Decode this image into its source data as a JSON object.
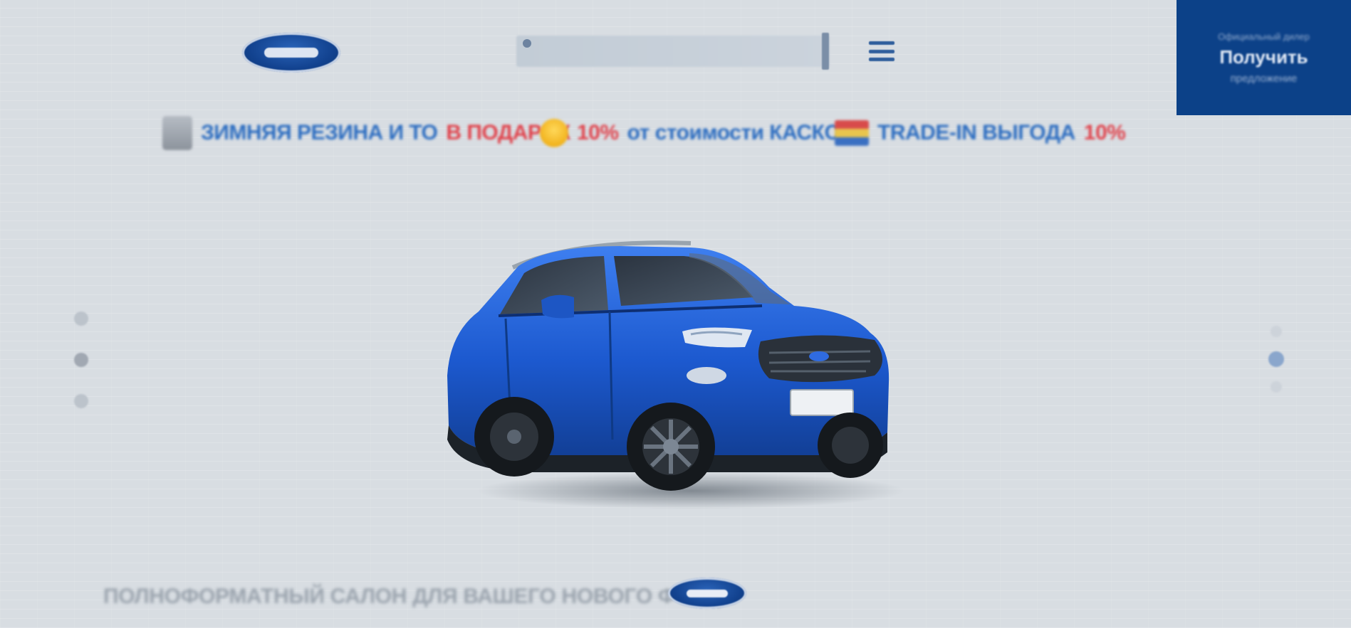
{
  "brand": {
    "logo_icon": "ford-oval-logo"
  },
  "header": {
    "search_icon": "search-icon",
    "menu_icon": "hamburger-menu-icon"
  },
  "promo_panel": {
    "line1": "Официальный дилер",
    "line2": "Получить",
    "line3": "предложение"
  },
  "benefits": [
    {
      "icon": "car-key-icon",
      "text_main": "ЗИМНЯЯ РЕЗИНА И ТО",
      "text_accent": "В ПОДАРОК"
    },
    {
      "icon": "gift-icon",
      "text_accent": "10%",
      "text_main": "от стоимости КАСКО*"
    },
    {
      "icon": "flag-icon",
      "text_main": "TRADE-IN ВЫГОДА",
      "text_accent": "10%"
    }
  ],
  "carousel": {
    "left_dots": 3,
    "right_dots": 3,
    "active_right_index": 1
  },
  "car": {
    "model": "Ford EcoSport",
    "color": "#1f5fd1"
  },
  "footer": {
    "text": "ПОЛНОФОРМАТНЫЙ САЛОН ДЛЯ ВАШЕГО НОВОГО ФОРДА",
    "logo_icon": "ford-oval-logo"
  },
  "colors": {
    "accent_blue": "#0c4188",
    "accent_red": "#e0414a",
    "background": "#d8dde2"
  }
}
